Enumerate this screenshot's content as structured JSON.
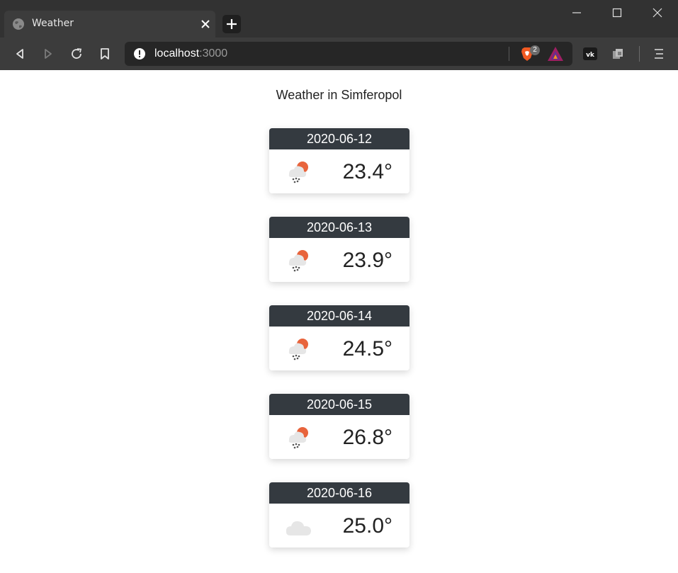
{
  "browser": {
    "tab_title": "Weather",
    "url_host": "localhost",
    "url_port": ":3000",
    "shields_badge": "2"
  },
  "page": {
    "title": "Weather in Simferopol"
  },
  "forecast": [
    {
      "date": "2020-06-12",
      "temp": "23.4°",
      "icon": "rain-sun-icon"
    },
    {
      "date": "2020-06-13",
      "temp": "23.9°",
      "icon": "rain-sun-icon"
    },
    {
      "date": "2020-06-14",
      "temp": "24.5°",
      "icon": "rain-sun-icon"
    },
    {
      "date": "2020-06-15",
      "temp": "26.8°",
      "icon": "rain-sun-icon"
    },
    {
      "date": "2020-06-16",
      "temp": "25.0°",
      "icon": "cloud-icon"
    }
  ],
  "colors": {
    "card_header": "#343a40",
    "sun": "#e8643c",
    "cloud": "#e6e6e6",
    "rain": "#555555"
  }
}
